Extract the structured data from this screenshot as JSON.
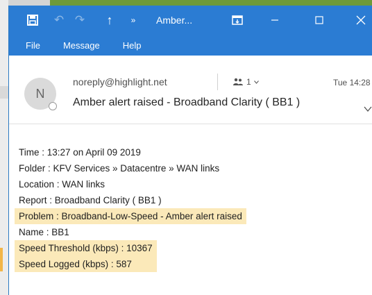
{
  "window": {
    "title": "Amber...",
    "menu": [
      "File",
      "Message",
      "Help"
    ]
  },
  "message": {
    "avatar_initial": "N",
    "sender": "noreply@highlight.net",
    "recipients": "1",
    "timestamp": "Tue 14:28",
    "subject": "Amber alert raised - Broadband Clarity ( BB1 )",
    "body_lines": [
      {
        "text": "Time : 13:27 on April 09 2019",
        "highlighted": false
      },
      {
        "text": "Folder : KFV Services » Datacentre » WAN links",
        "highlighted": false
      },
      {
        "text": "Location : WAN links",
        "highlighted": false
      },
      {
        "text": "Report : Broadband Clarity ( BB1 )",
        "highlighted": false
      },
      {
        "text": "Problem : Broadband-Low-Speed - Amber alert raised",
        "highlighted": true
      },
      {
        "text": "Name : BB1",
        "highlighted": false
      },
      {
        "text": "Speed Threshold (kbps) : 10367",
        "highlighted": true
      },
      {
        "text": "Speed Logged (kbps) : 587",
        "highlighted": true
      }
    ]
  },
  "colors": {
    "titlebar": "#2b7cd3",
    "highlight": "#fbe9b9",
    "alert_edge": "#f3b648"
  },
  "icons": {
    "save": "save-icon",
    "undo": "undo-icon",
    "redo": "redo-icon",
    "up": "up-arrow-icon",
    "more": "more-commands-icon",
    "restore": "restore-ribbon-icon",
    "minimize": "minimize-icon",
    "maximize": "maximize-icon",
    "close": "close-icon",
    "people": "people-icon",
    "expand": "chevron-down-icon"
  }
}
